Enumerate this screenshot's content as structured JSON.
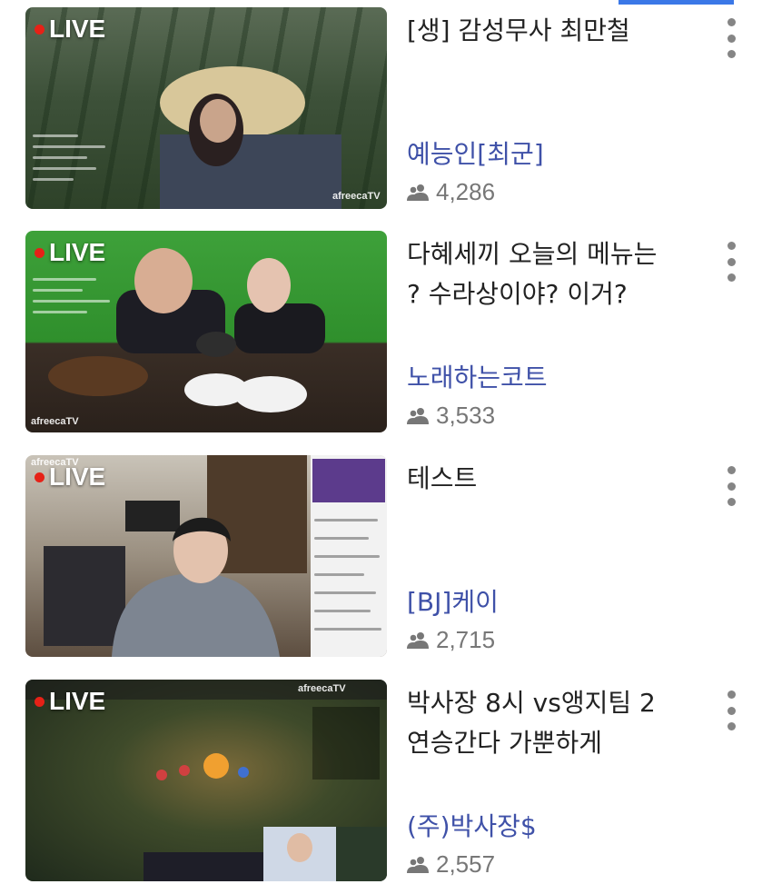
{
  "live_label": "LIVE",
  "colors": {
    "accent": "#3b78e7",
    "live_dot": "#e62117",
    "channel_text": "#3f51a8",
    "meta_text": "#777777"
  },
  "icons": {
    "viewers": "people-icon",
    "menu": "more-vert-icon"
  },
  "streams": [
    {
      "title": "[생] 감성무사 최만철",
      "channel": "예능인[최군]",
      "viewers": "4,286",
      "thumb_watermark": "afreecaTV"
    },
    {
      "title": "다혜세끼 오늘의 메뉴는\n? 수라상이야? 이거?",
      "channel": "노래하는코트",
      "viewers": "3,533",
      "thumb_watermark": "afreecaTV"
    },
    {
      "title": "테스트",
      "channel": "[BJ]케이",
      "viewers": "2,715",
      "thumb_watermark": "afreecaTV"
    },
    {
      "title": "박사장 8시 vs앵지팀 2\n연승간다 가뿐하게",
      "channel": "(주)박사장$",
      "viewers": "2,557",
      "thumb_watermark": "afreecaTV"
    }
  ]
}
